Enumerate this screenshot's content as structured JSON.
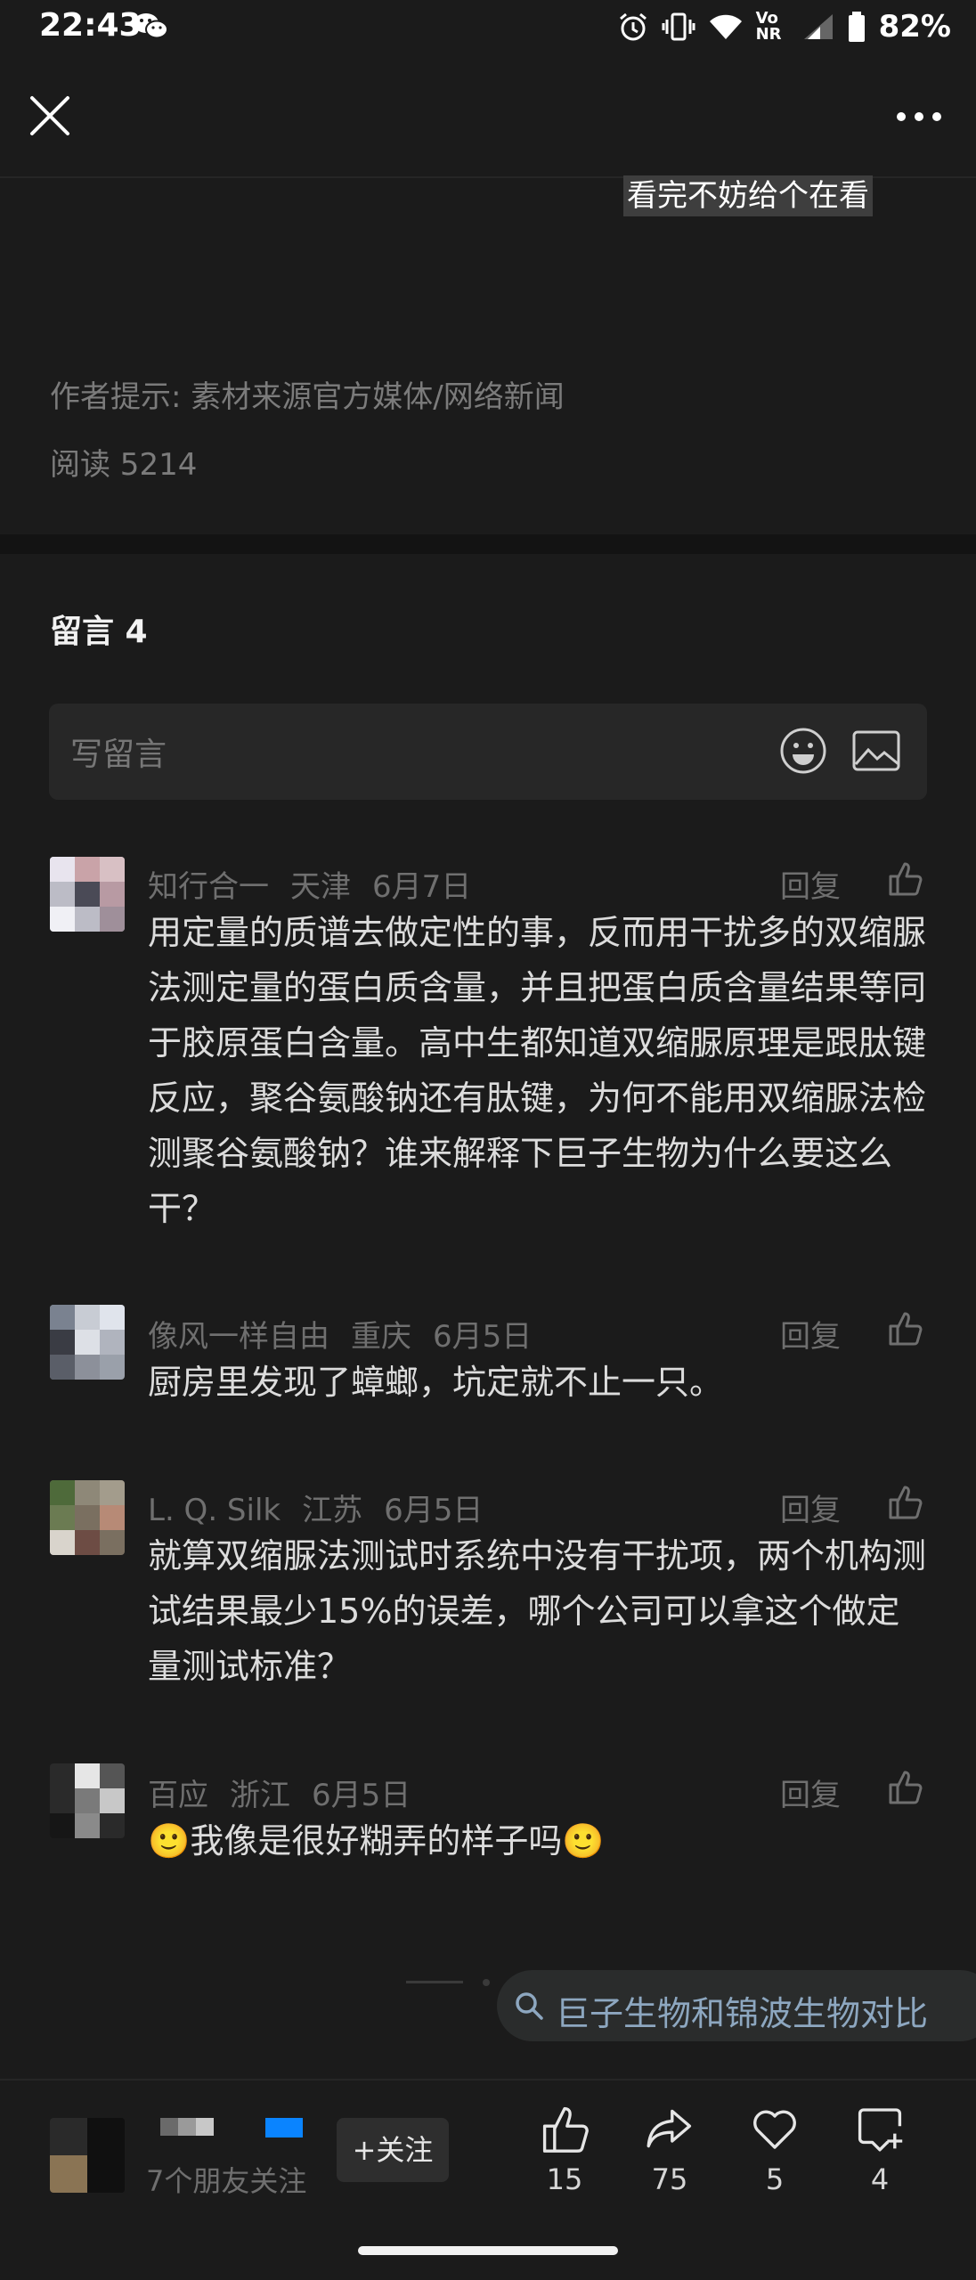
{
  "status_bar": {
    "time": "22:43",
    "network_label": "Vo NR",
    "battery": "82%"
  },
  "article": {
    "highlight": "看完不妨给个在看",
    "author_note": "作者提示: 素材来源官方媒体/网络新闻",
    "read_count": "阅读 5214"
  },
  "comments_section": {
    "title": "留言 4",
    "input_placeholder": "写留言",
    "reply_label": "回复",
    "items": [
      {
        "name": "知行合一",
        "location": "天津",
        "date": "6月7日",
        "text": "用定量的质谱去做定性的事，反而用干扰多的双缩脲法测定量的蛋白质含量，并且把蛋白质含量结果等同于胶原蛋白含量。高中生都知道双缩脲原理是跟肽键反应，聚谷氨酸钠还有肽键，为何不能用双缩脲法检测聚谷氨酸钠？谁来解释下巨子生物为什么要这么干？"
      },
      {
        "name": "像风一样自由",
        "location": "重庆",
        "date": "6月5日",
        "text": "厨房里发现了蟑螂，坑定就不止一只。"
      },
      {
        "name": "L. Q. Silk",
        "location": "江苏",
        "date": "6月5日",
        "text": "就算双缩脲法测试时系统中没有干扰项，两个机构测试结果最少15%的误差，哪个公司可以拿这个做定量测试标准？"
      },
      {
        "name": "百应",
        "location": "浙江",
        "date": "6月5日",
        "text": "🙂我像是很好糊弄的样子吗🙂"
      }
    ]
  },
  "search_suggestion": "巨子生物和锦波生物对比",
  "bottom_bar": {
    "friends_follow": "7个朋友关注",
    "follow_label": "+关注",
    "like_count": "15",
    "share_count": "75",
    "favorite_count": "5",
    "comment_count": "4"
  },
  "colors": {
    "background": "#1b1b1b",
    "accent": "#0a84ff",
    "suggestion_text": "#8da7c0"
  }
}
